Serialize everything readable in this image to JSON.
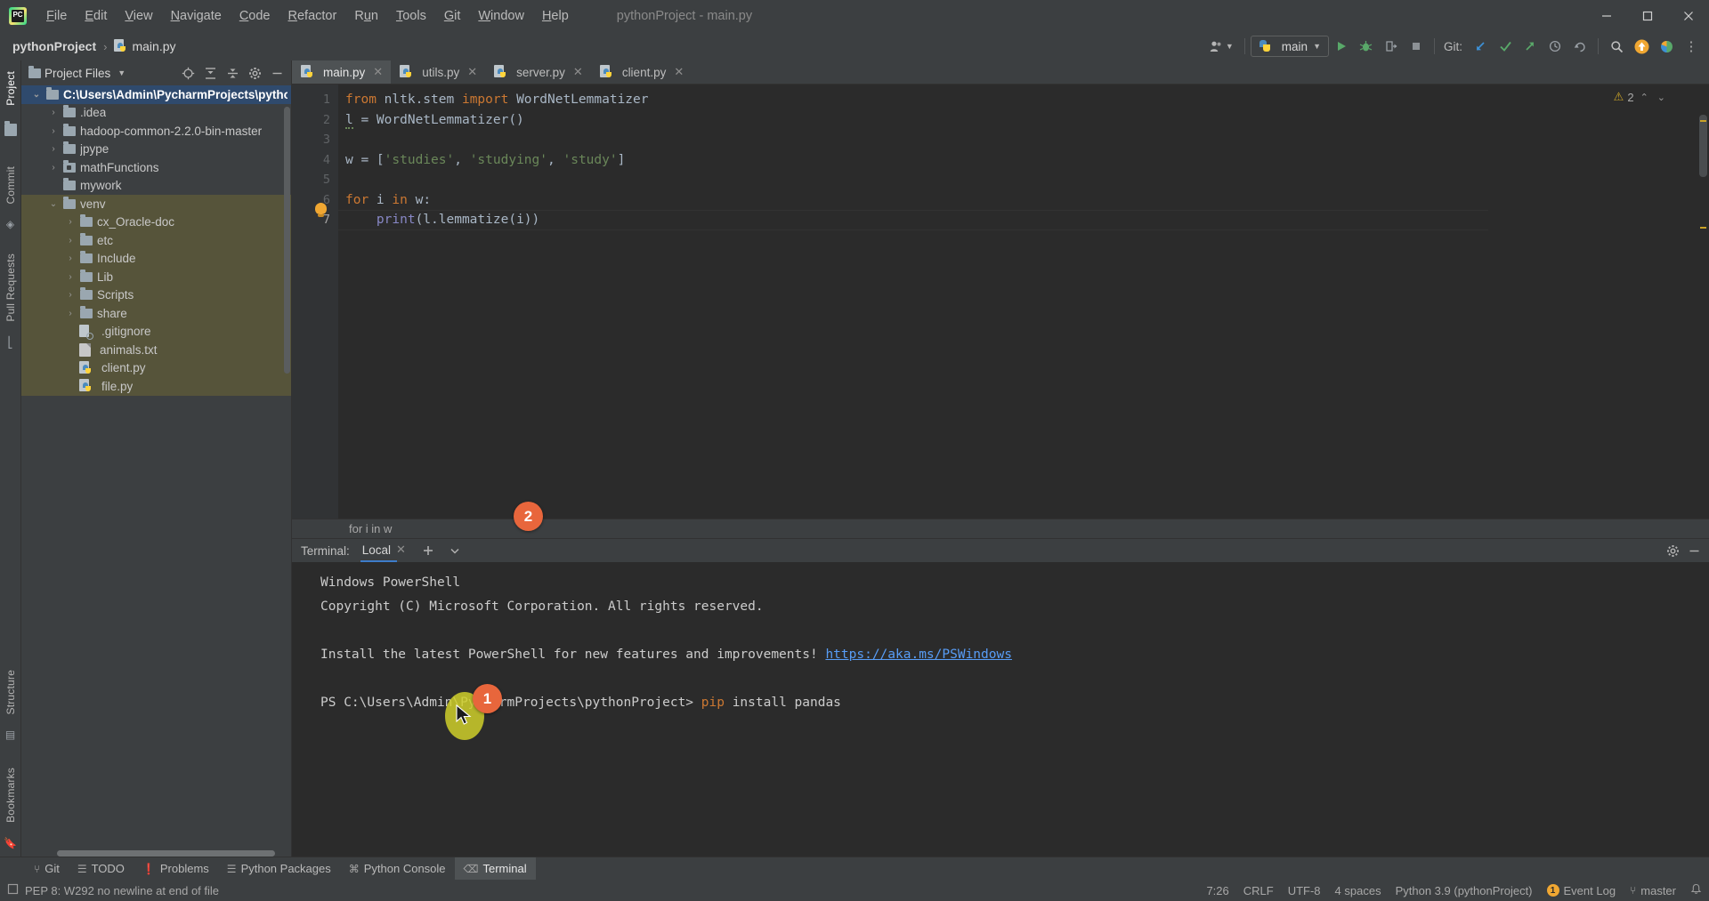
{
  "window": {
    "title": "pythonProject - main.py",
    "controls": {
      "minimize": "—",
      "maximize": "❐",
      "close": "✕"
    }
  },
  "menubar": {
    "items": [
      {
        "label": "File",
        "mnemonic": "F"
      },
      {
        "label": "Edit",
        "mnemonic": "E"
      },
      {
        "label": "View",
        "mnemonic": "V"
      },
      {
        "label": "Navigate",
        "mnemonic": "N"
      },
      {
        "label": "Code",
        "mnemonic": "C"
      },
      {
        "label": "Refactor",
        "mnemonic": "R"
      },
      {
        "label": "Run",
        "mnemonic": "R"
      },
      {
        "label": "Tools",
        "mnemonic": "T"
      },
      {
        "label": "Git",
        "mnemonic": "G"
      },
      {
        "label": "Window",
        "mnemonic": "W"
      },
      {
        "label": "Help",
        "mnemonic": "H"
      }
    ]
  },
  "navbar": {
    "breadcrumb": {
      "project": "pythonProject",
      "separator": "›",
      "file": "main.py"
    },
    "account_icon": "account-icon",
    "run_config": {
      "name": "main",
      "icon": "python-icon",
      "chevron": "▼"
    },
    "actions": [
      {
        "name": "run-button",
        "glyph": "▶",
        "color": "#59a869"
      },
      {
        "name": "debug-button",
        "glyph": "⚿",
        "color": "#59a869"
      },
      {
        "name": "run-with-coverage-button",
        "glyph": "⮌",
        "color": "#9aa0a6"
      },
      {
        "name": "stop-button",
        "glyph": "■",
        "color": "#9aa0a6"
      }
    ],
    "git_label": "Git:",
    "git_actions": [
      {
        "name": "update-project-button",
        "glyph": "↙",
        "color": "#3d91d6"
      },
      {
        "name": "commit-button",
        "glyph": "✓",
        "color": "#59a869"
      },
      {
        "name": "push-button",
        "glyph": "↗",
        "color": "#59a869"
      },
      {
        "name": "history-button",
        "glyph": "◴",
        "color": "#9aa0a6"
      },
      {
        "name": "rollback-button",
        "glyph": "↶",
        "color": "#9aa0a6"
      }
    ],
    "search_icon": "⌕",
    "update_badge_icon": "↑",
    "ide_icon": "ide-icon",
    "more_icon": "⋮"
  },
  "left_strip": {
    "top": [
      "Project"
    ],
    "middle": [
      "Commit",
      "Pull Requests"
    ],
    "bottom": [
      "Structure",
      "Bookmarks"
    ]
  },
  "project_panel": {
    "header": {
      "title": "Project Files",
      "chevron": "▼",
      "icons": [
        {
          "name": "select-opened-file-icon",
          "glyph": "⌖"
        },
        {
          "name": "expand-all-icon",
          "glyph": "⤓"
        },
        {
          "name": "collapse-all-icon",
          "glyph": "⤒"
        },
        {
          "name": "settings-gear-icon",
          "glyph": "⚙"
        },
        {
          "name": "hide-panel-icon",
          "glyph": "—"
        }
      ]
    },
    "tree": [
      {
        "label": "C:\\Users\\Admin\\PycharmProjects\\pythonProj",
        "indent": 0,
        "arrow": "⌄",
        "icon": "folder",
        "state": "selected"
      },
      {
        "label": ".idea",
        "indent": 1,
        "arrow": "›",
        "icon": "folder",
        "state": "normal"
      },
      {
        "label": "hadoop-common-2.2.0-bin-master",
        "indent": 1,
        "arrow": "›",
        "icon": "folder",
        "state": "normal"
      },
      {
        "label": "jpype",
        "indent": 1,
        "arrow": "›",
        "icon": "folder",
        "state": "normal"
      },
      {
        "label": "mathFunctions",
        "indent": 1,
        "arrow": "›",
        "icon": "folder-source",
        "state": "normal"
      },
      {
        "label": "mywork",
        "indent": 1,
        "arrow": "",
        "icon": "folder",
        "state": "normal"
      },
      {
        "label": "venv",
        "indent": 1,
        "arrow": "⌄",
        "icon": "folder",
        "state": "excluded"
      },
      {
        "label": "cx_Oracle-doc",
        "indent": 2,
        "arrow": "›",
        "icon": "folder",
        "state": "excluded"
      },
      {
        "label": "etc",
        "indent": 2,
        "arrow": "›",
        "icon": "folder",
        "state": "excluded"
      },
      {
        "label": "Include",
        "indent": 2,
        "arrow": "›",
        "icon": "folder",
        "state": "excluded"
      },
      {
        "label": "Lib",
        "indent": 2,
        "arrow": "›",
        "icon": "folder",
        "state": "excluded"
      },
      {
        "label": "Scripts",
        "indent": 2,
        "arrow": "›",
        "icon": "folder",
        "state": "excluded"
      },
      {
        "label": "share",
        "indent": 2,
        "arrow": "›",
        "icon": "folder",
        "state": "excluded"
      },
      {
        "label": ".gitignore",
        "indent": 2,
        "arrow": "",
        "icon": "ignored-file",
        "state": "excluded"
      },
      {
        "label": "animals.txt",
        "indent": 2,
        "arrow": "",
        "icon": "text-file",
        "state": "excluded"
      },
      {
        "label": "client.py",
        "indent": 2,
        "arrow": "",
        "icon": "python-file",
        "state": "excluded"
      },
      {
        "label": "file.py",
        "indent": 2,
        "arrow": "",
        "icon": "python-file",
        "state": "excluded"
      }
    ]
  },
  "editor": {
    "tabs": [
      {
        "label": "main.py",
        "active": true,
        "close": "✕"
      },
      {
        "label": "utils.py",
        "active": false,
        "close": "✕"
      },
      {
        "label": "server.py",
        "active": false,
        "close": "✕"
      },
      {
        "label": "client.py",
        "active": false,
        "close": "✕"
      }
    ],
    "line_numbers": [
      "1",
      "2",
      "3",
      "4",
      "5",
      "6",
      "7"
    ],
    "code_lines": [
      [
        {
          "t": "from ",
          "c": "kw"
        },
        {
          "t": "nltk.stem ",
          "c": "pl"
        },
        {
          "t": "import ",
          "c": "kw"
        },
        {
          "t": "WordNetLemmatizer",
          "c": "pl"
        }
      ],
      [
        {
          "t": "l = WordNetLemmatizer()",
          "c": "pl"
        }
      ],
      [
        {
          "t": "",
          "c": "pl"
        }
      ],
      [
        {
          "t": "w = [",
          "c": "pl"
        },
        {
          "t": "'studies'",
          "c": "str"
        },
        {
          "t": ", ",
          "c": "pl"
        },
        {
          "t": "'studying'",
          "c": "str"
        },
        {
          "t": ", ",
          "c": "pl"
        },
        {
          "t": "'study'",
          "c": "str"
        },
        {
          "t": "]",
          "c": "pl"
        }
      ],
      [
        {
          "t": "",
          "c": "pl"
        }
      ],
      [
        {
          "t": "for ",
          "c": "kw"
        },
        {
          "t": "i ",
          "c": "pl"
        },
        {
          "t": "in ",
          "c": "kw"
        },
        {
          "t": "w:",
          "c": "pl"
        }
      ],
      [
        {
          "t": "    ",
          "c": "pl"
        },
        {
          "t": "print",
          "c": "bi"
        },
        {
          "t": "(l.lemmatize(i))",
          "c": "pl"
        }
      ]
    ],
    "intention_bulb": "lightbulb-icon",
    "inspection_count": "2",
    "inspection_icon": "warning-triangle-icon",
    "chevron_up": "⌃",
    "chevron_down": "⌄",
    "breadcrumb": "for i in w"
  },
  "terminal": {
    "label": "Terminal:",
    "tab": {
      "label": "Local",
      "close": "✕"
    },
    "new_tab_icon": "➕",
    "chevron_icon": "⌄",
    "settings_icon": "⚙",
    "hide_icon": "—",
    "lines": [
      {
        "text": "Windows PowerShell"
      },
      {
        "text": "Copyright (C) Microsoft Corporation. All rights reserved."
      },
      {
        "text": ""
      },
      {
        "text": "Install the latest PowerShell for new features and improvements! ",
        "link": "https://aka.ms/PSWindows"
      },
      {
        "text": ""
      },
      {
        "prompt": "PS C:\\Users\\Admin\\PycharmProjects\\pythonProject> ",
        "cmd": "pip",
        "args": " install pandas"
      }
    ]
  },
  "tool_window_bar": {
    "tabs": [
      {
        "label": "Git",
        "icon": "branch-icon",
        "glyph": "⑂",
        "active": false
      },
      {
        "label": "TODO",
        "icon": "list-icon",
        "glyph": "☰",
        "active": false
      },
      {
        "label": "Problems",
        "icon": "error-icon",
        "glyph": "❗",
        "active": false
      },
      {
        "label": "Python Packages",
        "icon": "packages-icon",
        "glyph": "☰",
        "active": false
      },
      {
        "label": "Python Console",
        "icon": "python-icon",
        "glyph": "⌘",
        "active": false
      },
      {
        "label": "Terminal",
        "icon": "terminal-icon",
        "glyph": "⌫",
        "active": true
      }
    ]
  },
  "status_bar": {
    "inspection_icon": "inspection-icon",
    "message": "PEP 8: W292 no newline at end of file",
    "caret_position": "7:26",
    "line_separator": "CRLF",
    "encoding": "UTF-8",
    "indent": "4 spaces",
    "interpreter": "Python 3.9 (pythonProject)",
    "branch": "master",
    "branch_icon": "⑂",
    "event_log": {
      "label": "Event Log",
      "count": "1"
    },
    "notification_icon": "⑂"
  },
  "annotations": [
    {
      "id": "1",
      "label": "1"
    },
    {
      "id": "2",
      "label": "2"
    }
  ]
}
